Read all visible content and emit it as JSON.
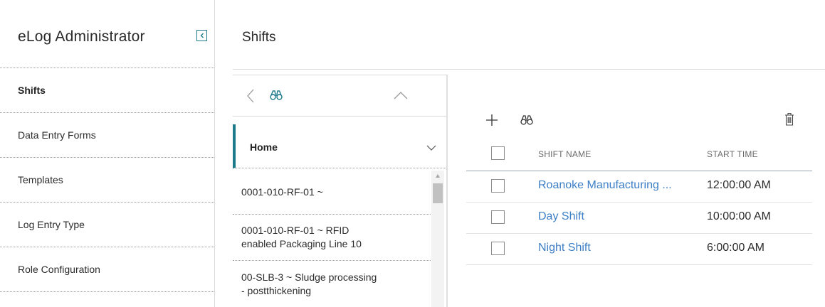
{
  "sidebar": {
    "title": "eLog Administrator",
    "items": [
      {
        "label": "Shifts",
        "active": true
      },
      {
        "label": "Data Entry Forms",
        "active": false
      },
      {
        "label": "Templates",
        "active": false
      },
      {
        "label": "Log Entry Type",
        "active": false
      },
      {
        "label": "Role Configuration",
        "active": false
      }
    ]
  },
  "page": {
    "title": "Shifts"
  },
  "tree": {
    "toolbar_icons": [
      "back-icon",
      "binoculars-icon",
      "chevron-up-icon"
    ],
    "home_label": "Home",
    "items": [
      {
        "line1": "0001-010-RF-01 ~",
        "line2": ""
      },
      {
        "line1": "0001-010-RF-01 ~ RFID",
        "line2": "enabled Packaging Line 10"
      },
      {
        "line1": "00-SLB-3 ~ Sludge processing",
        "line2": "- postthickening"
      }
    ]
  },
  "grid": {
    "toolbar_icons": [
      "plus-icon",
      "binoculars-icon",
      "trash-icon"
    ],
    "columns": {
      "name": "SHIFT NAME",
      "start_time": "START TIME"
    },
    "rows": [
      {
        "name": "Roanoke Manufacturing ...",
        "start_time": "12:00:00 AM"
      },
      {
        "name": "Day Shift",
        "start_time": "10:00:00 AM"
      },
      {
        "name": "Night Shift",
        "start_time": "6:00:00 AM"
      }
    ]
  },
  "colors": {
    "accent": "#1d7a8a",
    "link": "#3c7fc6",
    "divider": "#d9d9d9"
  }
}
